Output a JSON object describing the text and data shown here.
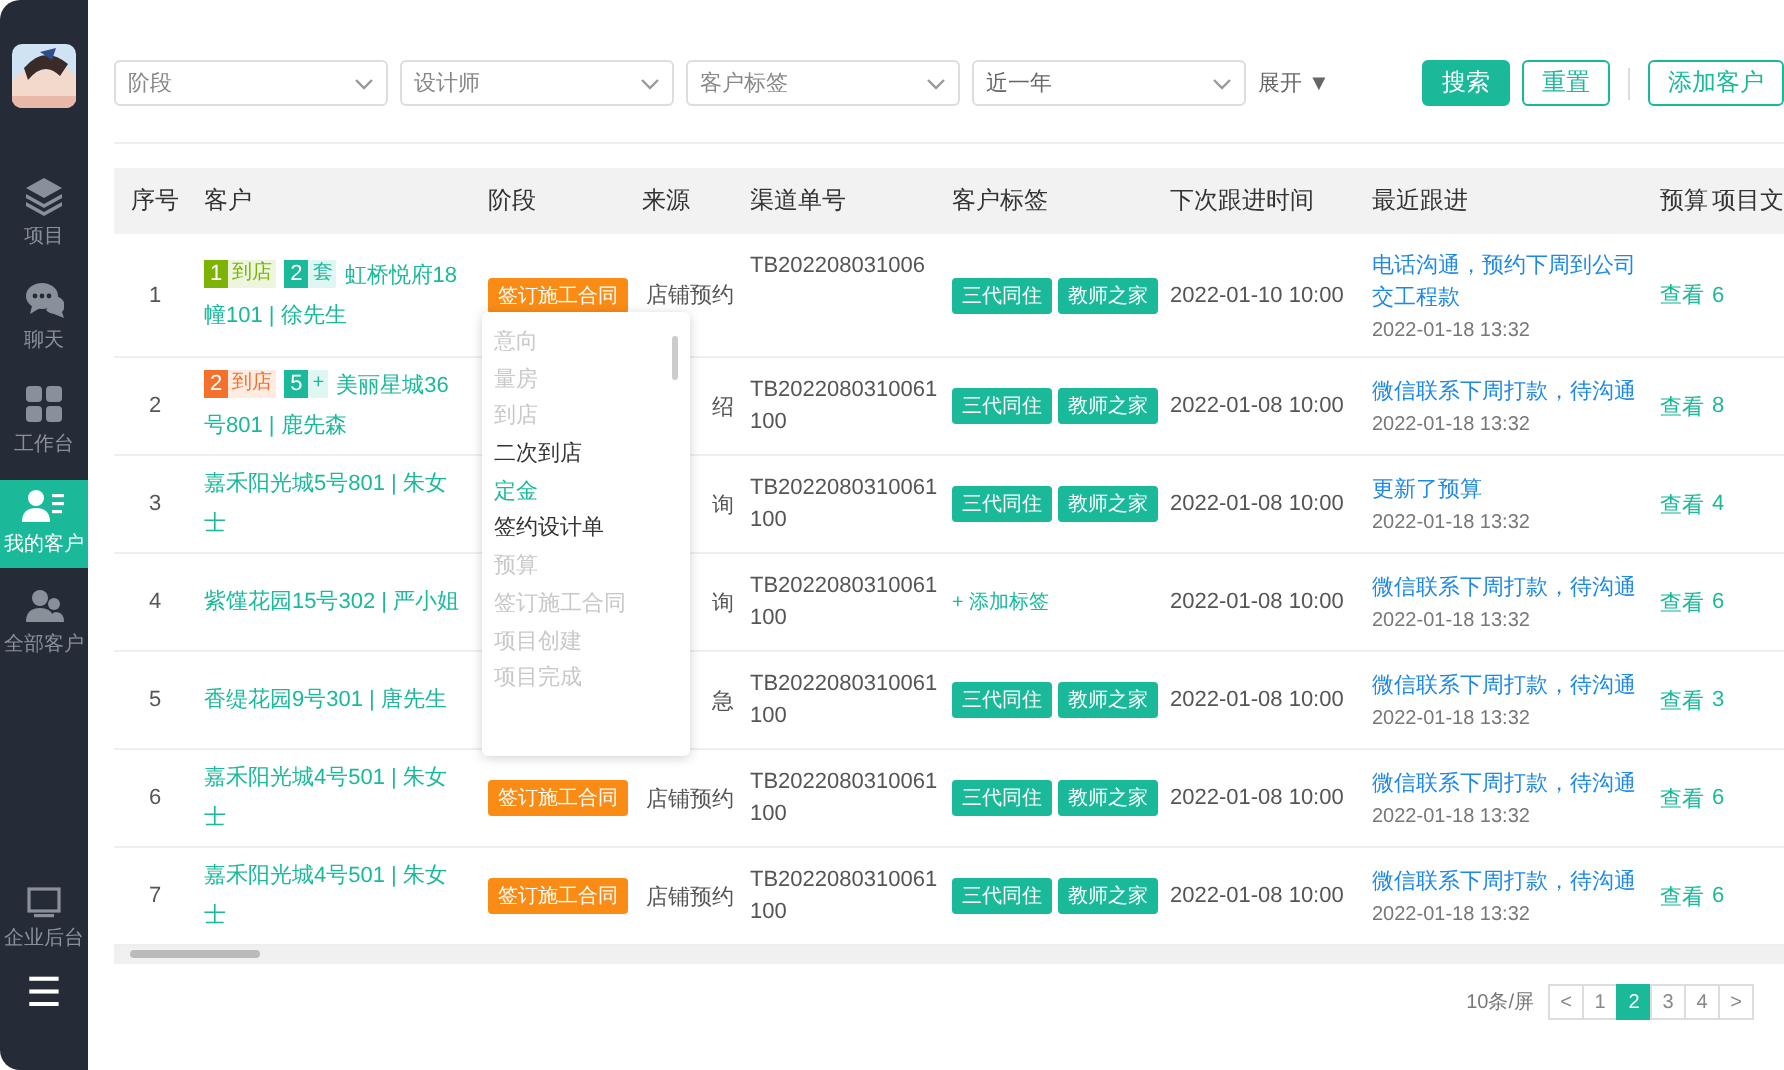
{
  "sidebar": {
    "items": [
      {
        "label": "项目",
        "selected": false
      },
      {
        "label": "聊天",
        "selected": false
      },
      {
        "label": "工作台",
        "selected": false
      },
      {
        "label": "我的客户",
        "selected": true
      },
      {
        "label": "全部客户",
        "selected": false
      }
    ],
    "bottom": [
      {
        "label": "企业后台"
      }
    ],
    "menu_icon": "☰"
  },
  "filters": [
    {
      "placeholder": "阶段"
    },
    {
      "placeholder": "设计师"
    },
    {
      "placeholder": "客户标签"
    },
    {
      "value": "近一年"
    }
  ],
  "expand": "展开 ▼",
  "buttons": [
    {
      "label": "搜索",
      "kind": "primary"
    },
    {
      "label": "重置",
      "kind": "outline"
    },
    {
      "label": "添加客户",
      "kind": "outline"
    }
  ],
  "table": {
    "columns": [
      "序号",
      "客户",
      "阶段",
      "来源",
      "渠道单号",
      "客户标签",
      "下次跟进时间",
      "最近跟进",
      "预算",
      "项目文"
    ],
    "rows": [
      {
        "no": "1",
        "badges": [
          {
            "num": "1",
            "text": "到店",
            "color": "#7cb305"
          },
          {
            "num": "2",
            "text": "套",
            "color": "#19b99a"
          }
        ],
        "customer": "虹桥悦府18幢101 | 徐先生",
        "stage": "签订施工合同",
        "source": "店铺预约",
        "channel": "TB202208031006",
        "tags": [
          {
            "kind": "tag",
            "text": "三代同住"
          },
          {
            "kind": "tag",
            "text": "教师之家"
          }
        ],
        "next": "2022-01-10 10:00",
        "recent": "电话沟通，预约下周到公司交工程款",
        "recent_time": "2022-01-18 13:32",
        "budget": "查看",
        "project": "6"
      },
      {
        "no": "2",
        "badges": [
          {
            "num": "2",
            "text": "到店",
            "color": "#f5702a"
          },
          {
            "num": "5",
            "text": "+",
            "color": "#19b99a"
          }
        ],
        "customer": "美丽星城36号801 | 鹿先森",
        "source": "绍",
        "channel": "TB2022080310061100",
        "tags": [
          {
            "kind": "tag",
            "text": "三代同住"
          },
          {
            "kind": "tag",
            "text": "教师之家"
          }
        ],
        "next": "2022-01-08 10:00",
        "recent": "微信联系下周打款，待沟通",
        "recent_time": "2022-01-18 13:32",
        "budget": "查看",
        "project": "8"
      },
      {
        "no": "3",
        "customer": "嘉禾阳光城5号801 | 朱女士",
        "source": "询",
        "channel": "TB2022080310061100",
        "tags": [
          {
            "kind": "tag",
            "text": "三代同住"
          },
          {
            "kind": "tag",
            "text": "教师之家"
          }
        ],
        "next": "2022-01-08 10:00",
        "recent": "更新了预算",
        "recent_time": "2022-01-18 13:32",
        "budget": "查看",
        "project": "4"
      },
      {
        "no": "4",
        "customer": "紫馑花园15号302 | 严小姐",
        "source": "询",
        "channel": "TB2022080310061100",
        "tags": [
          {
            "kind": "add",
            "text": "+ 添加标签"
          }
        ],
        "next": "2022-01-08 10:00",
        "recent": "微信联系下周打款，待沟通",
        "recent_time": "2022-01-18 13:32",
        "budget": "查看",
        "project": "6"
      },
      {
        "no": "5",
        "customer": "香缇花园9号301 | 唐先生",
        "source": "急",
        "channel": "TB2022080310061100",
        "tags": [
          {
            "kind": "tag",
            "text": "三代同住"
          },
          {
            "kind": "tag",
            "text": "教师之家"
          }
        ],
        "next": "2022-01-08 10:00",
        "recent": "微信联系下周打款，待沟通",
        "recent_time": "2022-01-18 13:32",
        "budget": "查看",
        "project": "3"
      },
      {
        "no": "6",
        "customer": "嘉禾阳光城4号501 | 朱女士",
        "stage": "签订施工合同",
        "source": "店铺预约",
        "channel": "TB2022080310061100",
        "tags": [
          {
            "kind": "tag",
            "text": "三代同住"
          },
          {
            "kind": "tag",
            "text": "教师之家"
          }
        ],
        "next": "2022-01-08 10:00",
        "recent": "微信联系下周打款，待沟通",
        "recent_time": "2022-01-18 13:32",
        "budget": "查看",
        "project": "6"
      },
      {
        "no": "7",
        "customer": "嘉禾阳光城4号501 | 朱女士",
        "stage": "签订施工合同",
        "source": "店铺预约",
        "channel": "TB2022080310061100",
        "tags": [
          {
            "kind": "tag",
            "text": "三代同住"
          },
          {
            "kind": "tag",
            "text": "教师之家"
          }
        ],
        "next": "2022-01-08 10:00",
        "recent": "微信联系下周打款，待沟通",
        "recent_time": "2022-01-18 13:32",
        "budget": "查看",
        "project": "6"
      }
    ]
  },
  "stage_dropdown": {
    "options": [
      {
        "label": "意向",
        "disabled": true,
        "selected": false
      },
      {
        "label": "量房",
        "disabled": true,
        "selected": false
      },
      {
        "label": "到店",
        "disabled": true,
        "selected": false
      },
      {
        "label": "二次到店",
        "disabled": false,
        "selected": false
      },
      {
        "label": "定金",
        "disabled": false,
        "selected": true
      },
      {
        "label": "签约设计单",
        "disabled": false,
        "selected": false
      },
      {
        "label": "预算",
        "disabled": true,
        "selected": false
      },
      {
        "label": "签订施工合同",
        "disabled": true,
        "selected": false
      },
      {
        "label": "项目创建",
        "disabled": true,
        "selected": false
      },
      {
        "label": "项目完成",
        "disabled": true,
        "selected": false
      }
    ]
  },
  "pagination": {
    "page_size": "10条/屏",
    "prev": "<",
    "next": ">",
    "pages": [
      {
        "label": "1",
        "selected": false
      },
      {
        "label": "2",
        "selected": true
      },
      {
        "label": "3",
        "selected": false
      },
      {
        "label": "4",
        "selected": false
      }
    ]
  }
}
